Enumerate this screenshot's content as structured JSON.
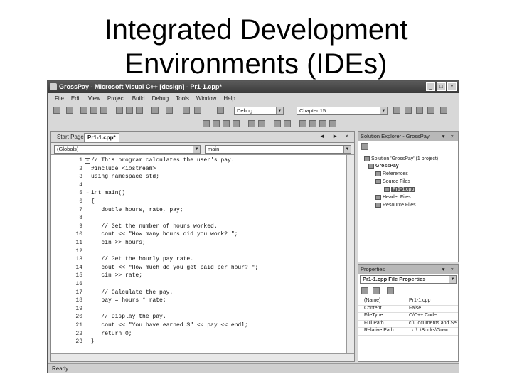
{
  "slide": {
    "title_line1": "Integrated Development",
    "title_line2": "Environments (IDEs)"
  },
  "window": {
    "title": "GrossPay - Microsoft Visual C++ [design] - Pr1-1.cpp*",
    "buttons": [
      "_",
      "□",
      "×"
    ]
  },
  "menu": [
    "File",
    "Edit",
    "View",
    "Project",
    "Build",
    "Debug",
    "Tools",
    "Window",
    "Help"
  ],
  "toolbar": {
    "config_value": "Debug",
    "find_value": "Chapter 15"
  },
  "editor": {
    "tabs": [
      "Start Page",
      "Pr1-1.cpp*"
    ],
    "nav_controls": "◄ ► ×",
    "scope_combo": "(Globals)",
    "member_combo": "main",
    "lines": [
      {
        "n": "1",
        "fold": "−",
        "code": "// This program calculates the user's pay."
      },
      {
        "n": "2",
        "fold": "",
        "code": "#include <iostream>"
      },
      {
        "n": "3",
        "fold": "",
        "code": "using namespace std;"
      },
      {
        "n": "4",
        "fold": "",
        "code": ""
      },
      {
        "n": "5",
        "fold": "−",
        "code": "int main()"
      },
      {
        "n": "6",
        "fold": "",
        "code": "{"
      },
      {
        "n": "7",
        "fold": "",
        "code": "   double hours, rate, pay;"
      },
      {
        "n": "8",
        "fold": "",
        "code": ""
      },
      {
        "n": "9",
        "fold": "",
        "code": "   // Get the number of hours worked."
      },
      {
        "n": "10",
        "fold": "",
        "code": "   cout << \"How many hours did you work? \";"
      },
      {
        "n": "11",
        "fold": "",
        "code": "   cin >> hours;"
      },
      {
        "n": "12",
        "fold": "",
        "code": ""
      },
      {
        "n": "13",
        "fold": "",
        "code": "   // Get the hourly pay rate."
      },
      {
        "n": "14",
        "fold": "",
        "code": "   cout << \"How much do you get paid per hour? \";"
      },
      {
        "n": "15",
        "fold": "",
        "code": "   cin >> rate;"
      },
      {
        "n": "16",
        "fold": "",
        "code": ""
      },
      {
        "n": "17",
        "fold": "",
        "code": "   // Calculate the pay."
      },
      {
        "n": "18",
        "fold": "",
        "code": "   pay = hours * rate;"
      },
      {
        "n": "19",
        "fold": "",
        "code": ""
      },
      {
        "n": "20",
        "fold": "",
        "code": "   // Display the pay."
      },
      {
        "n": "21",
        "fold": "",
        "code": "   cout << \"You have earned $\" << pay << endl;"
      },
      {
        "n": "22",
        "fold": "",
        "code": "   return 0;"
      },
      {
        "n": "23",
        "fold": "",
        "code": "}"
      }
    ]
  },
  "solution_explorer": {
    "title": "Solution Explorer - GrossPay",
    "controls": "▾ ×",
    "items": [
      {
        "label": "Solution 'GrossPay' (1 project)"
      },
      {
        "label": "GrossPay"
      },
      {
        "label": "References"
      },
      {
        "label": "Source Files"
      },
      {
        "label": "Pr1-1.cpp"
      },
      {
        "label": "Header Files"
      },
      {
        "label": "Resource Files"
      }
    ]
  },
  "properties": {
    "title": "Properties",
    "controls": "▾ ×",
    "object_combo": "Pr1-1.cpp  File Properties",
    "rows": [
      {
        "name": "(Name)",
        "value": "Pr1-1.cpp"
      },
      {
        "name": "Content",
        "value": "False"
      },
      {
        "name": "FileType",
        "value": "C/C++ Code"
      },
      {
        "name": "Full Path",
        "value": "c:\\Documents and Se"
      },
      {
        "name": "Relative Path",
        "value": "..\\..\\..\\Books\\Gowo"
      }
    ]
  },
  "status": {
    "text": "Ready"
  }
}
